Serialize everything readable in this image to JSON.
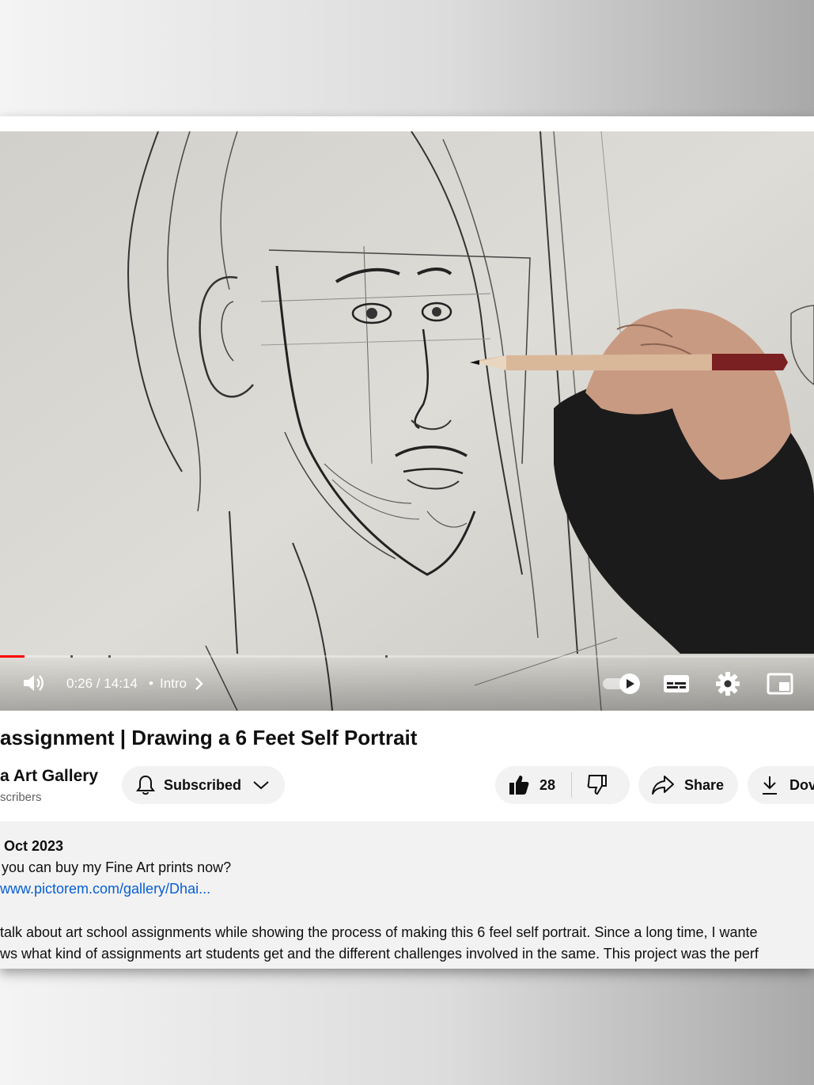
{
  "player": {
    "current_time": "0:26",
    "separator": "/",
    "duration": "14:14",
    "dot": "•",
    "chapter": "Intro",
    "progress_fraction": 0.03,
    "autoplay_on": true
  },
  "video": {
    "title": "assignment | Drawing a 6 Feet Self Portrait"
  },
  "channel": {
    "name": "a Art Gallery",
    "subscribers": "scribers",
    "subscribe_label": "Subscribed"
  },
  "actions": {
    "like_count": "28",
    "share_label": "Share",
    "download_label": "Dov"
  },
  "description": {
    "date": "Oct 2023",
    "line1": "you can buy my Fine Art prints now?",
    "link": "www.pictorem.com/gallery/Dhai...",
    "line2": "talk about art school assignments while showing the process of making this 6 feel self portrait. Since a long time, I wante",
    "line3": "ws what kind of assignments art students get and the different challenges involved in the same. This project was the perf"
  },
  "colors": {
    "progress_red": "#ff0000",
    "link_blue": "#065fd4",
    "pill_bg": "#f2f2f2"
  },
  "icons": [
    "volume-icon",
    "chevron-right-icon",
    "autoplay-toggle-icon",
    "subtitles-icon",
    "settings-gear-icon",
    "miniplayer-icon",
    "bell-icon",
    "chevron-down-icon",
    "thumbs-up-icon",
    "thumbs-down-icon",
    "share-arrow-icon",
    "download-icon"
  ]
}
